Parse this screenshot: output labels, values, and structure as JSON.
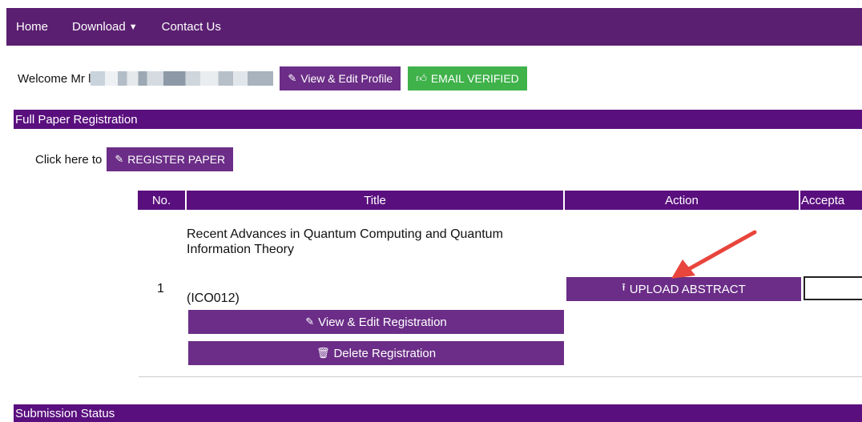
{
  "nav": {
    "home": "Home",
    "download": "Download",
    "contact": "Contact Us"
  },
  "welcome": {
    "prefix": "Welcome Mr l",
    "edit_profile": "View & Edit Profile",
    "email_verified": "EMAIL VERIFIED"
  },
  "full_paper": {
    "heading": "Full Paper Registration",
    "click_here": "Click here to",
    "register_button": "REGISTER PAPER"
  },
  "table": {
    "headers": [
      "No.",
      "Title",
      "Action",
      "Accepta"
    ],
    "row": {
      "no": "1",
      "title": "Recent Advances in Quantum Computing and Quantum Information Theory",
      "code": "(ICO012)",
      "edit_button": "View & Edit Registration",
      "delete_button": "Delete Registration",
      "upload_button": "UPLOAD ABSTRACT"
    }
  },
  "submission_status": {
    "heading": "Submission Status"
  },
  "colors": {
    "nav_bg": "#5a1f70",
    "section_bg": "#5a0f7e",
    "button_purple": "#6b2d87",
    "button_green": "#3fb24a",
    "arrow": "#e8453c"
  },
  "icons": {
    "edit": "edit-icon",
    "thumbs_up": "thumbs-up-icon",
    "upload": "upload-icon",
    "trash": "trash-icon",
    "caret": "caret-down-icon"
  }
}
